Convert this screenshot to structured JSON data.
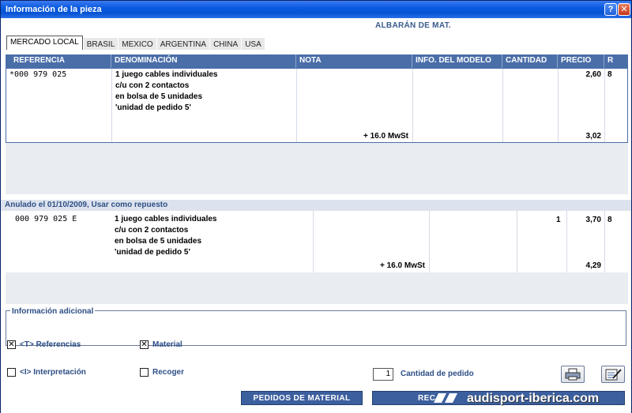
{
  "window": {
    "title": "Información de la pieza",
    "help_label": "?",
    "close_label": "✕"
  },
  "doc_title": "ALBARÁN DE MAT.",
  "tabs": [
    {
      "label": "MERCADO LOCAL",
      "active": true
    },
    {
      "label": "BRASIL",
      "active": false
    },
    {
      "label": "MEXICO",
      "active": false
    },
    {
      "label": "ARGENTINA",
      "active": false
    },
    {
      "label": "CHINA",
      "active": false
    },
    {
      "label": "USA",
      "active": false
    }
  ],
  "table_header": {
    "referencia": "REFERENCIA",
    "denominacion": "DENOMINACIÓN",
    "nota": "NOTA",
    "info_modelo": "INFO. DEL MODELO",
    "cantidad": "CANTIDAD",
    "precio": "PRECIO",
    "r": "R"
  },
  "item1": {
    "referencia": "*000 979 025",
    "desc": [
      "1 juego cables individuales",
      "c/u con 2 contactos",
      "en bolsa de 5 unidades",
      "'unidad de pedido 5'"
    ],
    "precio": "2,60",
    "r": "8",
    "tax": "+ 16.0 MwSt",
    "precio_tax": "3,02"
  },
  "anulado": "Anulado el 01/10/2009, Usar como repuesto",
  "item2": {
    "referencia": "000 979 025 E",
    "desc": [
      "1 juego cables individuales",
      "c/u con 2 contactos",
      "en bolsa de 5 unidades",
      "'unidad de pedido 5'"
    ],
    "cantidad": "1",
    "precio": "3,70",
    "r": "8",
    "tax": "+ 16.0 MwSt",
    "precio_tax": "4,29"
  },
  "info_adicional": "Información adicional",
  "checkboxes": {
    "referencias": {
      "label": "<T> Referencias",
      "checked": true
    },
    "material": {
      "label": "Material",
      "checked": true
    },
    "interpretacion": {
      "label": "<I> Interpretación",
      "checked": false
    },
    "recoger": {
      "label": "Recoger",
      "checked": false
    }
  },
  "order": {
    "quantity": "1",
    "quantity_label": "Cantidad de pedido"
  },
  "buttons": {
    "pedidos": "PEDIDOS DE MATERIAL",
    "recoger": "REC"
  },
  "watermark": "audisport-iberica.com",
  "check_mark": "✕"
}
